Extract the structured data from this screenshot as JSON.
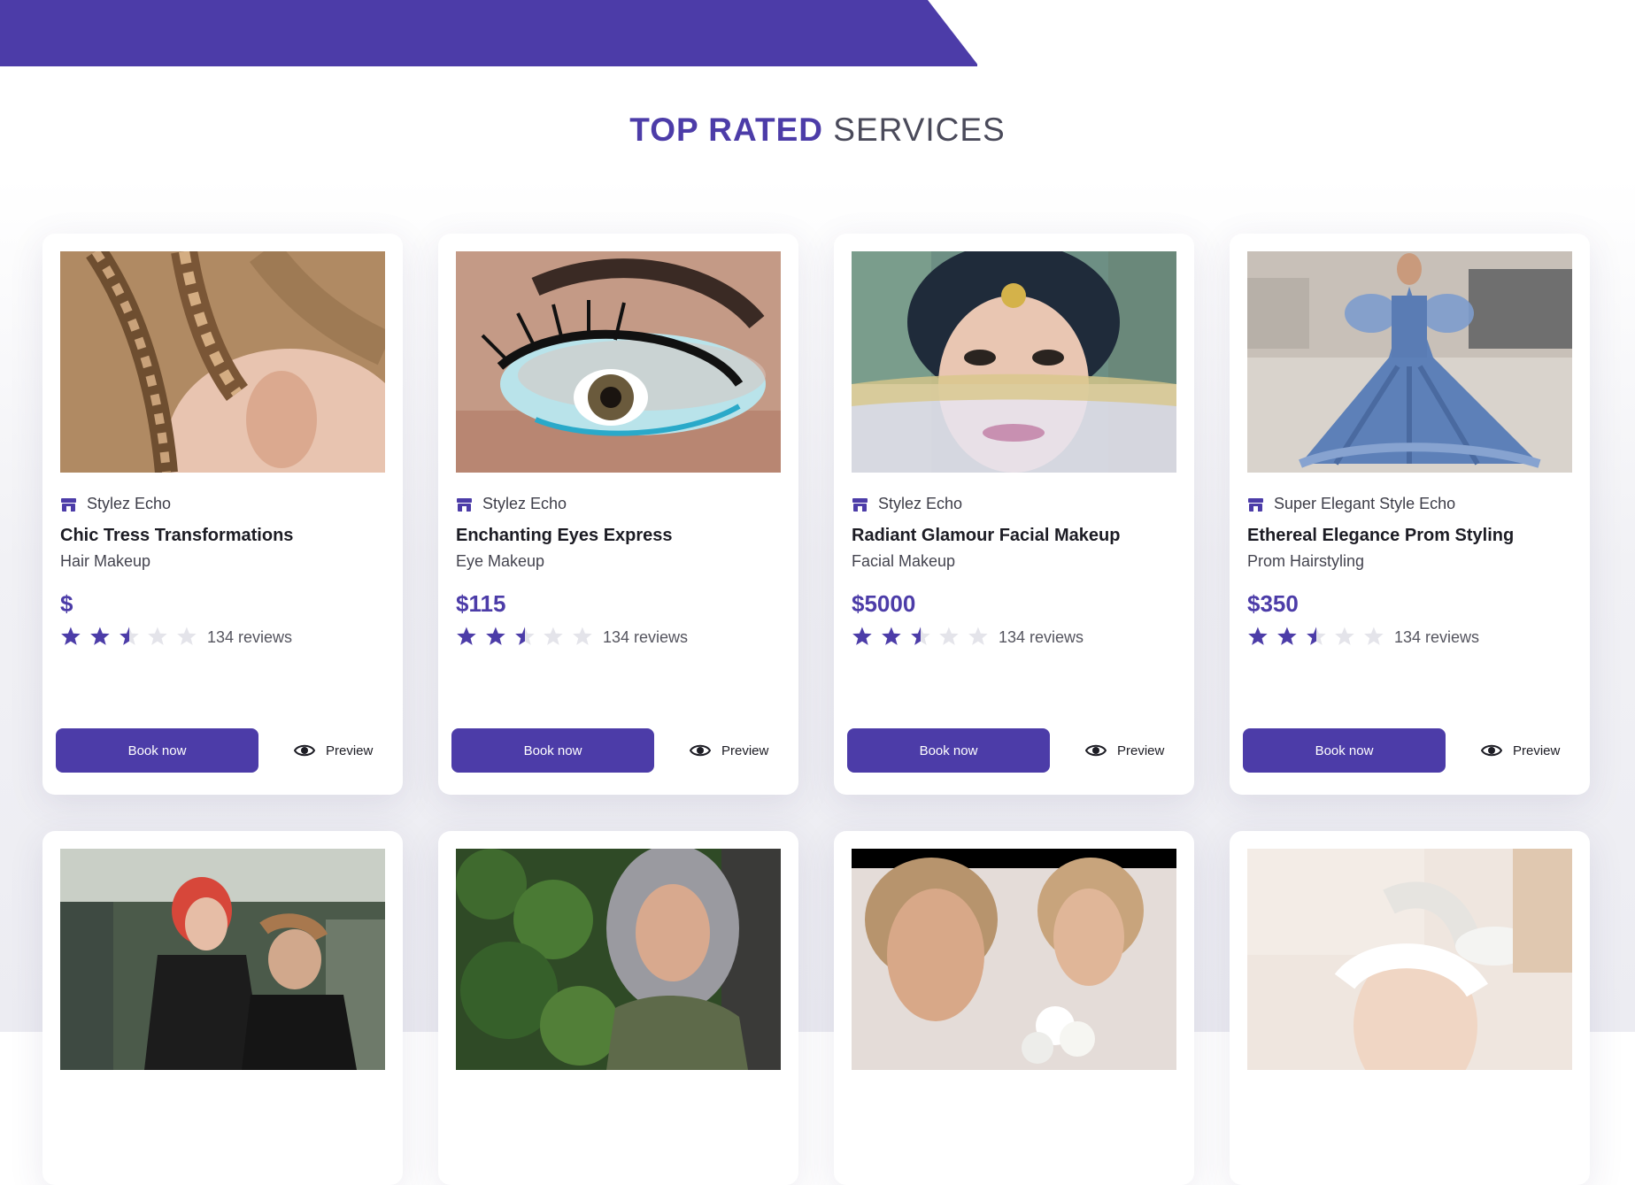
{
  "section": {
    "title_highlight": "TOP RATED",
    "title_rest": "SERVICES"
  },
  "colors": {
    "accent": "#4c3ca8",
    "star_filled": "#4c3ca8",
    "star_empty": "#e4e4ea"
  },
  "services": [
    {
      "shop": "Stylez Echo",
      "name": "Chic Tress Transformations",
      "category": "Hair Makeup",
      "price": "$",
      "rating": 2.5,
      "reviews": "134 reviews",
      "book_label": "Book now",
      "preview_label": "Preview",
      "image_subject": "braided hair"
    },
    {
      "shop": "Stylez Echo",
      "name": "Enchanting Eyes Express",
      "category": "Eye Makeup",
      "price": "$115",
      "rating": 2.5,
      "reviews": "134 reviews",
      "book_label": "Book now",
      "preview_label": "Preview",
      "image_subject": "eye makeup closeup"
    },
    {
      "shop": "Stylez Echo",
      "name": "Radiant Glamour Facial Makeup",
      "category": "Facial Makeup",
      "price": "$5000",
      "rating": 2.5,
      "reviews": "134 reviews",
      "book_label": "Book now",
      "preview_label": "Preview",
      "image_subject": "bridal face with veil"
    },
    {
      "shop": "Super Elegant Style Echo",
      "name": "Ethereal Elegance Prom Styling",
      "category": "Prom Hairstyling",
      "price": "$350",
      "rating": 2.5,
      "reviews": "134 reviews",
      "book_label": "Book now",
      "preview_label": "Preview",
      "image_subject": "blue prom gown"
    }
  ],
  "row2_images": [
    "salon haircut",
    "woman in garden",
    "bridal portraits",
    "facial treatment"
  ]
}
